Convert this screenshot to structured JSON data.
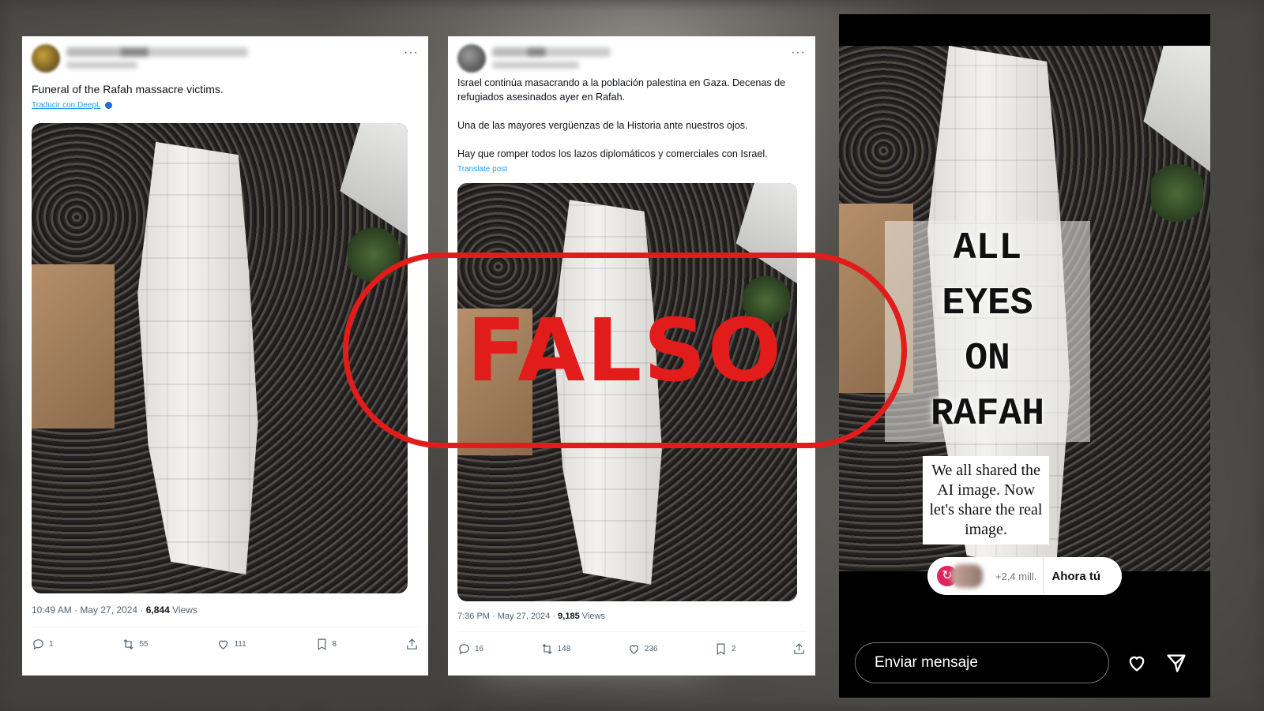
{
  "tweet1": {
    "text": "Funeral of the Rafah massacre victims.",
    "translate_link": "Traducir con DeepL",
    "timestamp": "10:49 AM · May 27, 2024 · ",
    "views_count": "6,844",
    "views_label": " Views",
    "actions": {
      "replies": "1",
      "reposts": "55",
      "likes": "111",
      "bookmarks": "8"
    }
  },
  "tweet2": {
    "paragraphs": [
      "Israel continúa masacrando a la población palestina en Gaza. Decenas de refugiados asesinados ayer en Rafah.",
      "Una de las mayores vergüenzas de la Historia ante nuestros ojos.",
      "Hay que romper todos los lazos diplomáticos y comerciales con Israel."
    ],
    "translate_link": "Translate post",
    "timestamp": "7:36 PM · May 27, 2024 · ",
    "views_count": "9,185",
    "views_label": " Views",
    "actions": {
      "replies": "16",
      "reposts": "148",
      "likes": "236",
      "bookmarks": "2"
    }
  },
  "story": {
    "headline_lines": [
      "ALL",
      "EYES",
      "ON",
      "RAFAH"
    ],
    "note": "We all shared the AI image. Now let's share the real image.",
    "participants": "+2,4 mill.",
    "cta": "Ahora tú",
    "message_placeholder": "Enviar mensaje"
  },
  "stamp": {
    "text": "FALSO",
    "color": "#e21b1b"
  },
  "icons": [
    "more-icon",
    "reply-icon",
    "repost-icon",
    "like-icon",
    "bookmark-icon",
    "share-icon",
    "heart-icon",
    "send-icon"
  ]
}
